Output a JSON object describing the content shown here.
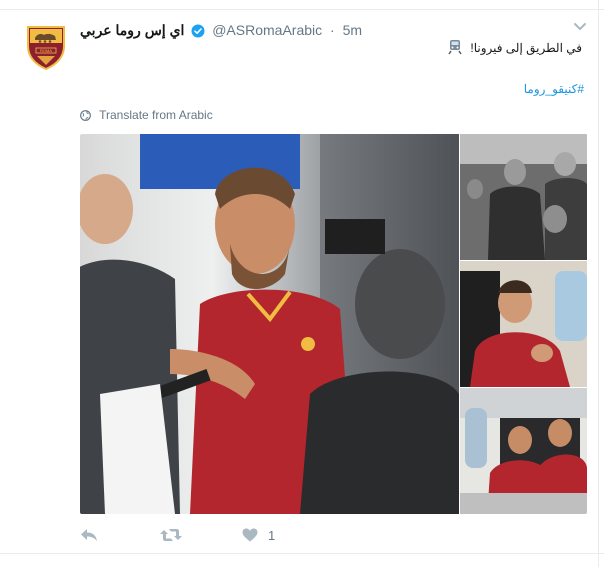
{
  "tweet": {
    "display_name": "اي إس روما عربي",
    "handle": "@ASRomaArabic",
    "separator": "·",
    "time": "5m",
    "text_line1": "في الطريق إلى فيرونا!",
    "hashtag": "#كنيقو_روما",
    "translate_label": "Translate from Arabic",
    "like_count": "1"
  },
  "icons": {
    "avatar": "as-roma-crest-icon",
    "verified": "verified-badge-icon",
    "caret": "chevron-down-icon",
    "emoji": "train-emoji-icon",
    "globe": "globe-icon",
    "reply": "reply-icon",
    "retweet": "retweet-icon",
    "like": "heart-icon"
  },
  "colors": {
    "link": "#1b95e0",
    "secondary_text": "#657786",
    "action_icon": "#aab8c2",
    "roma_red": "#8e1f2f",
    "roma_gold": "#f0bc42"
  }
}
